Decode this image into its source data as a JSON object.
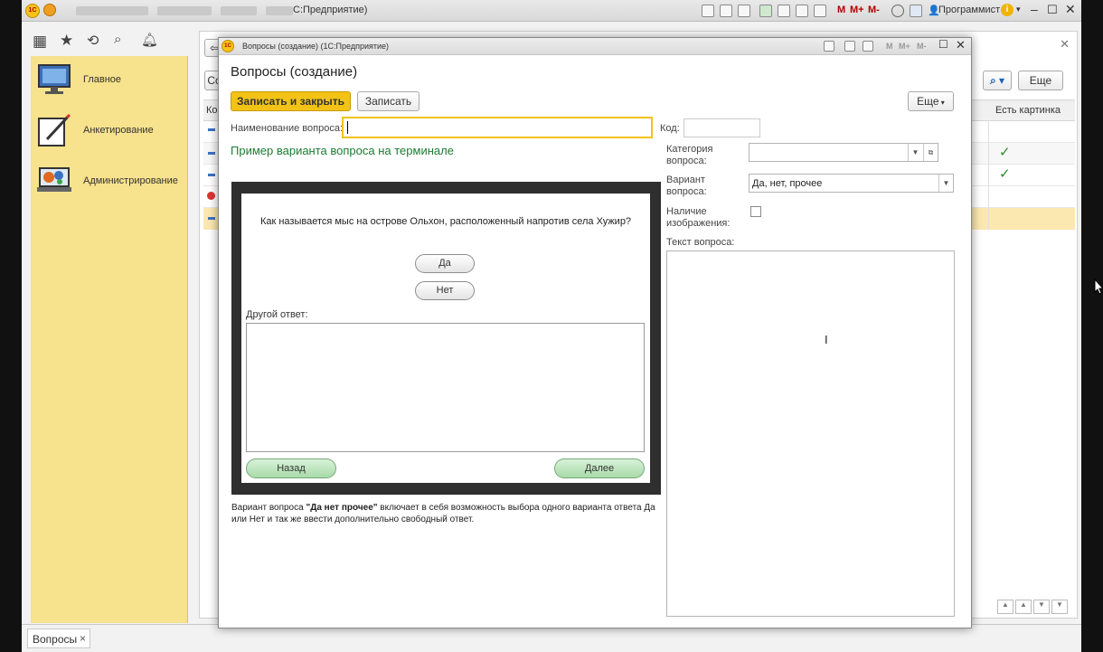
{
  "app": {
    "title": "С:Предприятие)",
    "user": "Программист",
    "m_buttons": [
      "M",
      "M+",
      "M-"
    ]
  },
  "sidebar": {
    "items": [
      {
        "label": "Главное",
        "icon": "monitor-icon"
      },
      {
        "label": "Анкетирование",
        "icon": "pencil-clipboard-icon"
      },
      {
        "label": "Администрирование",
        "icon": "gears-laptop-icon"
      }
    ]
  },
  "bgform": {
    "more_label": "Еще",
    "col_code_short": "Ко",
    "col_has_picture": "Есть картинка",
    "create_short": "Со"
  },
  "taskbar": {
    "tab_label": "Вопросы",
    "close": "×"
  },
  "modal": {
    "window_title": "Вопросы (создание) (1С:Предприятие)",
    "heading": "Вопросы (создание)",
    "save_close_label": "Записать и закрыть",
    "save_label": "Записать",
    "more_label": "Еще",
    "name_label": "Наименование вопроса:",
    "name_value": "",
    "code_label": "Код:",
    "code_value": "",
    "category_label": "Категория вопроса:",
    "category_value": "",
    "variant_label": "Вариант вопроса:",
    "variant_value": "Да, нет, прочее",
    "image_label": "Наличие изображения:",
    "text_label": "Текст вопроса:",
    "preview_heading": "Пример варианта вопроса на терминале",
    "description_pre": "Вариант вопроса ",
    "description_bold": "\"Да нет прочее\"",
    "description_post": " включает в себя возможность выбора одного варианта ответа Да или Нет и так же ввести дополнительно свободный ответ."
  },
  "terminal": {
    "question": "Как называется мыс на острове Ольхон, расположенный напротив села Хужир?",
    "yes": "Да",
    "no": "Нет",
    "other_label": "Другой ответ:",
    "back": "Назад",
    "next": "Далее"
  },
  "colors": {
    "accent_yellow": "#f2c316",
    "sidebar_bg": "#f7e28d",
    "green_heading": "#1e7a32"
  }
}
